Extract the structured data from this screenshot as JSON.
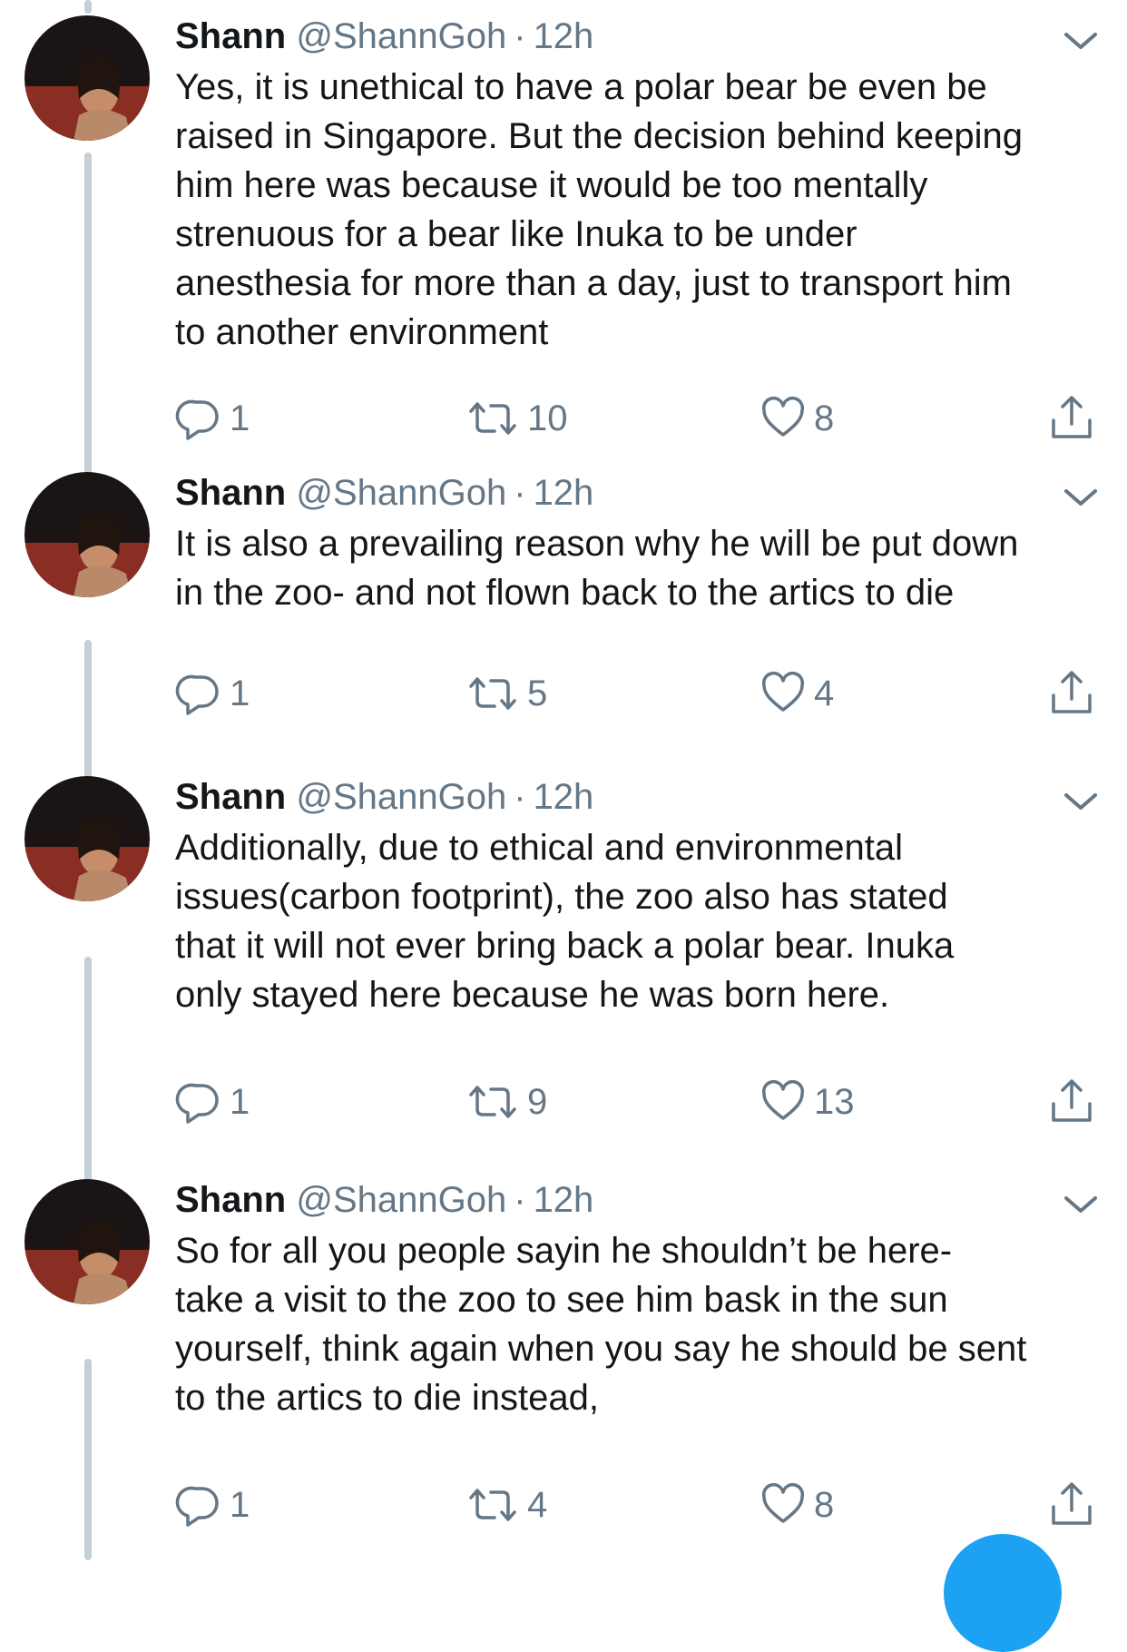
{
  "tweets": [
    {
      "name": "Shann",
      "handle": "@ShannGoh",
      "separator": "·",
      "time": "12h",
      "text_lines": [
        "Yes, it is unethical to have a polar bear be even be",
        "raised in Singapore. But the decision behind keeping",
        "him here was because it would be too mentally",
        "strenuous for a bear like Inuka to be under",
        "anesthesia for more than a day, just to transport him",
        "to another environment"
      ],
      "replies": "1",
      "retweets": "10",
      "likes": "8"
    },
    {
      "name": "Shann",
      "handle": "@ShannGoh",
      "separator": "·",
      "time": "12h",
      "text_lines": [
        "It is also a prevailing reason why he will be put down",
        "in the zoo- and not flown back to the artics to die"
      ],
      "replies": "1",
      "retweets": "5",
      "likes": "4"
    },
    {
      "name": "Shann",
      "handle": "@ShannGoh",
      "separator": "·",
      "time": "12h",
      "text_lines": [
        "Additionally, due to ethical and environmental",
        "issues(carbon footprint), the zoo also has stated",
        "that it will not ever bring back a polar bear. Inuka",
        "only stayed here because he was born here."
      ],
      "replies": "1",
      "retweets": "9",
      "likes": "13"
    },
    {
      "name": "Shann",
      "handle": "@ShannGoh",
      "separator": "·",
      "time": "12h",
      "text_lines": [
        "So for all you people sayin he shouldn’t be here-",
        "take a visit to the zoo to see him bask in the sun",
        "yourself, think again when you say he should be sent",
        "to the artics to die instead,"
      ],
      "replies": "1",
      "retweets": "4",
      "likes": "8"
    }
  ],
  "icons": {
    "reply": "reply-icon",
    "retweet": "retweet-icon",
    "like": "heart-icon",
    "share": "share-icon",
    "caret": "chevron-down-icon"
  },
  "colors": {
    "text": "#14171a",
    "secondary": "#657786",
    "thread_line": "#c4cfd6",
    "accent": "#1da1f2"
  }
}
